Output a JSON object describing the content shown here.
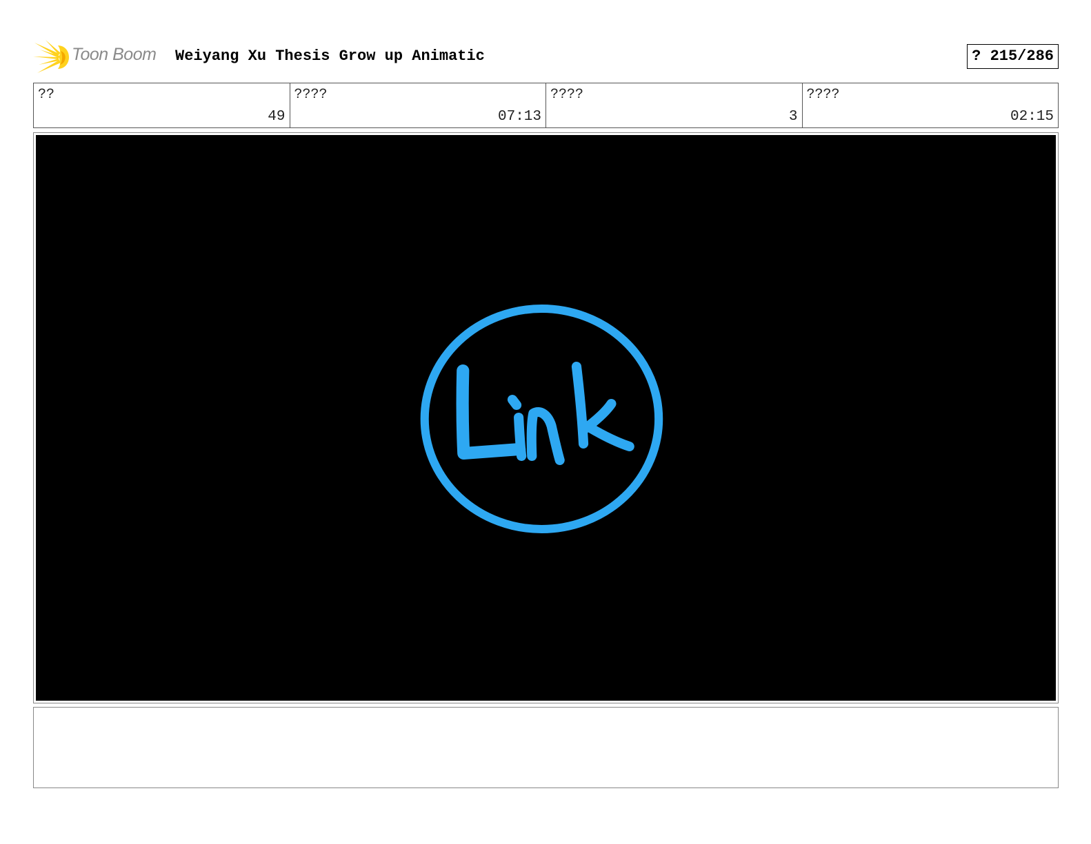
{
  "header": {
    "logo_text": "Toon Boom",
    "title": "Weiyang Xu Thesis Grow up Animatic",
    "page_counter": "? 215/286"
  },
  "info": [
    {
      "label": "??",
      "value": "49"
    },
    {
      "label": "????",
      "value": "07:13"
    },
    {
      "label": "????",
      "value": "3"
    },
    {
      "label": "????",
      "value": "02:15"
    }
  ],
  "panel": {
    "drawing_text": "Link",
    "background_color": "#000000",
    "stroke_color": "#2EA8F2"
  },
  "colors": {
    "logo_burst": "#FFD21E",
    "logo_text": "#8A8A8A"
  }
}
